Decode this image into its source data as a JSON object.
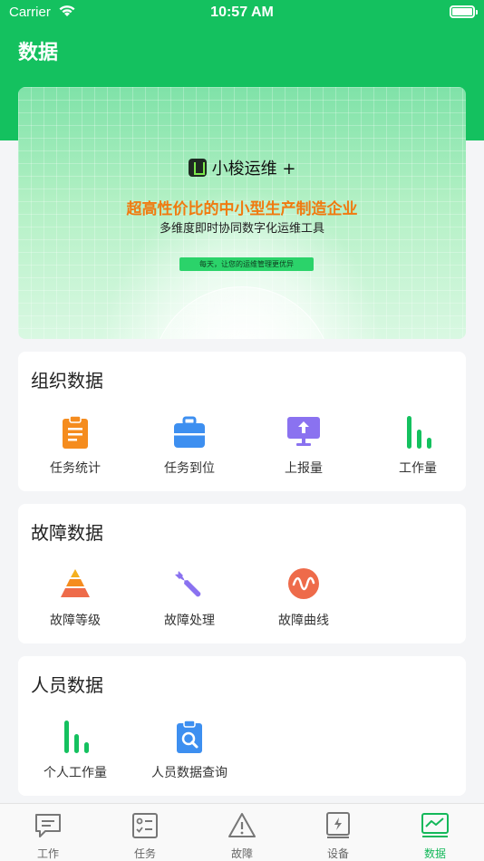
{
  "status_bar": {
    "carrier": "Carrier",
    "time": "10:57 AM"
  },
  "header": {
    "title": "数据"
  },
  "banner": {
    "brand": "小梭运维 +",
    "headline": "超高性价比的中小型生产制造企业",
    "subline": "多维度即时协同数字化运维工具",
    "tag": "每天，让您的运维管理更优异"
  },
  "sections": {
    "org": {
      "title": "组织数据",
      "items": [
        {
          "label": "任务统计",
          "icon": "clipboard-icon"
        },
        {
          "label": "任务到位",
          "icon": "briefcase-icon"
        },
        {
          "label": "上报量",
          "icon": "upload-monitor-icon"
        },
        {
          "label": "工作量",
          "icon": "bar-chart-icon"
        }
      ]
    },
    "fault": {
      "title": "故障数据",
      "items": [
        {
          "label": "故障等级",
          "icon": "pyramid-icon"
        },
        {
          "label": "故障处理",
          "icon": "wrench-icon"
        },
        {
          "label": "故障曲线",
          "icon": "wave-icon"
        }
      ]
    },
    "people": {
      "title": "人员数据",
      "items": [
        {
          "label": "个人工作量",
          "icon": "bar-chart-icon"
        },
        {
          "label": "人员数据查询",
          "icon": "search-clipboard-icon"
        }
      ]
    }
  },
  "tabbar": {
    "items": [
      {
        "label": "工作",
        "icon": "message-icon"
      },
      {
        "label": "任务",
        "icon": "checklist-icon"
      },
      {
        "label": "故障",
        "icon": "warning-icon"
      },
      {
        "label": "设备",
        "icon": "device-icon"
      },
      {
        "label": "数据",
        "icon": "chart-monitor-icon"
      }
    ],
    "active": "数据"
  },
  "colors": {
    "primary": "#14c15f",
    "orange": "#f58c1e",
    "blue": "#3d8ff0",
    "purple": "#8a72f0",
    "red": "#ee6b4a"
  }
}
